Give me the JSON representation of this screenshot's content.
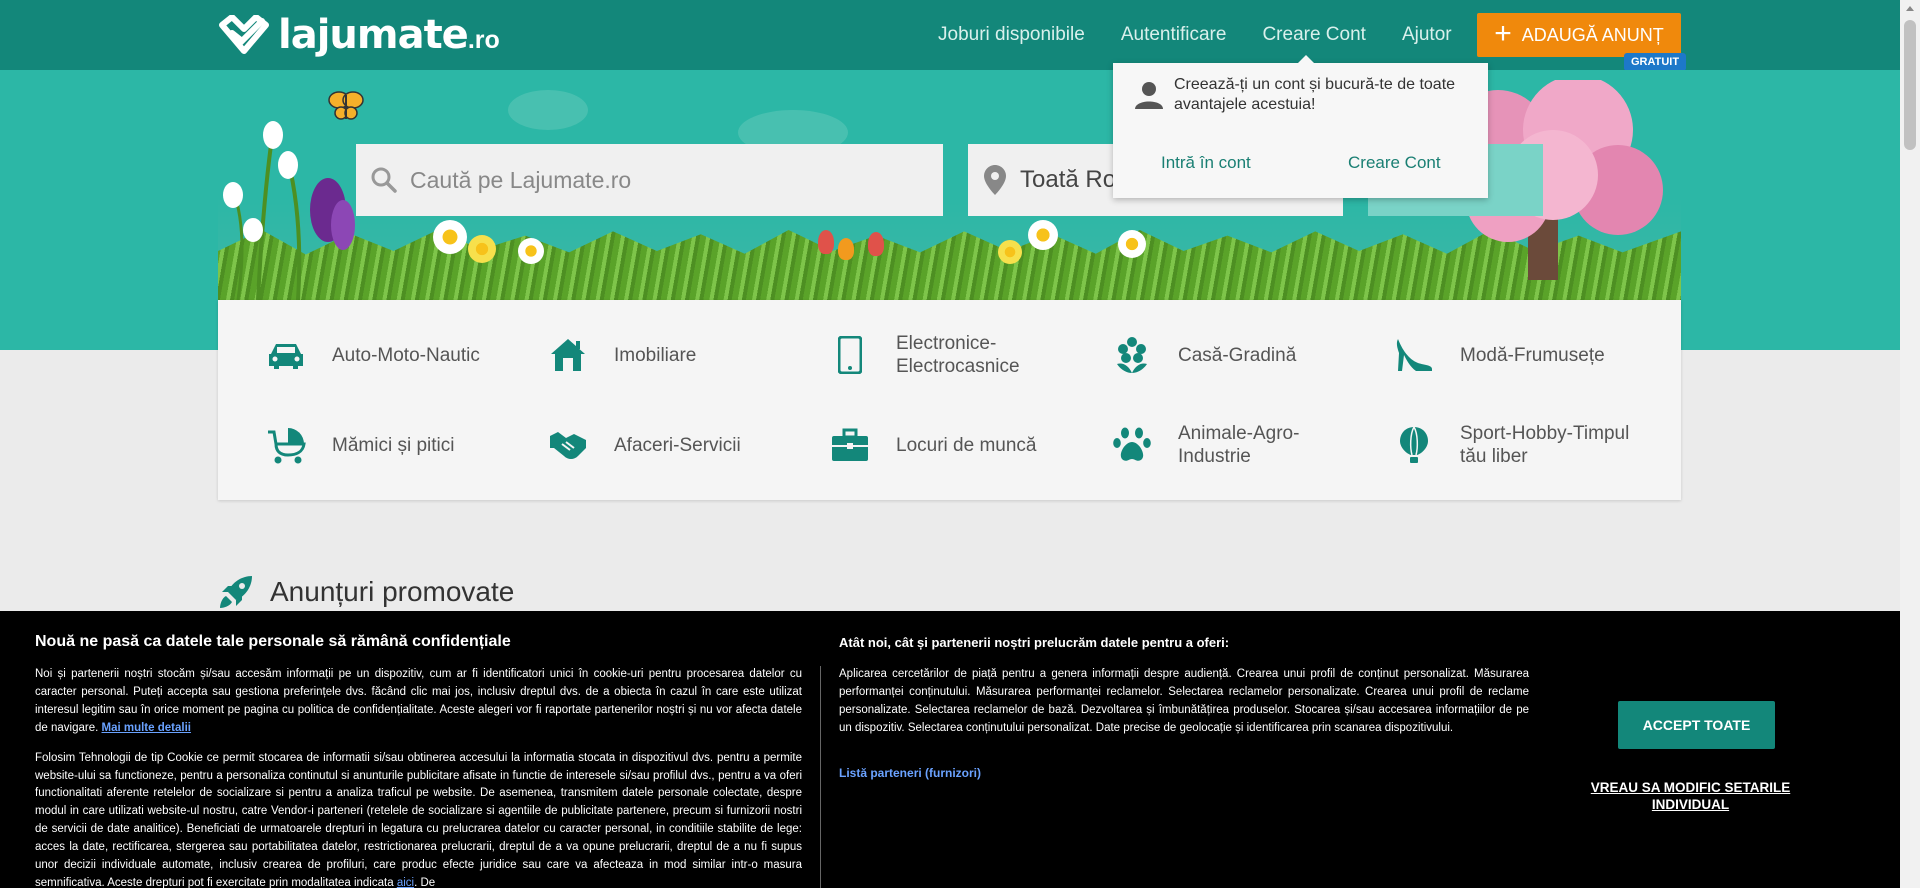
{
  "header": {
    "logo_text": "lajumate",
    "logo_tld": ".ro",
    "nav": [
      "Joburi disponibile",
      "Autentificare",
      "Creare Cont",
      "Ajutor"
    ],
    "add_button": "ADAUGĂ ANUNȚ",
    "badge": "GRATUIT"
  },
  "search": {
    "placeholder": "Caută pe Lajumate.ro",
    "location_value": "Toată Ron"
  },
  "dropdown": {
    "message": "Creează-ți un cont și bucură-te de toate avantajele acestuia!",
    "login_link": "Intră în cont",
    "create_link": "Creare Cont"
  },
  "categories": [
    {
      "label": "Auto-Moto-Nautic",
      "icon": "car-icon"
    },
    {
      "label": "Imobiliare",
      "icon": "house-icon"
    },
    {
      "label": "Electronice-Electrocasnice",
      "icon": "phone-icon"
    },
    {
      "label": "Casă-Gradină",
      "icon": "flower-icon"
    },
    {
      "label": "Modă-Frumusețe",
      "icon": "heel-icon"
    },
    {
      "label": "Mămici și pitici",
      "icon": "stroller-icon"
    },
    {
      "label": "Afaceri-Servicii",
      "icon": "handshake-icon"
    },
    {
      "label": "Locuri de muncă",
      "icon": "briefcase-icon"
    },
    {
      "label": "Animale-Agro-Industrie",
      "icon": "paw-icon"
    },
    {
      "label": "Sport-Hobby-Timpul tău liber",
      "icon": "balloon-icon"
    }
  ],
  "promoted": {
    "title": "Anunțuri promovate"
  },
  "cookie": {
    "title": "Nouă ne pasă ca datele tale personale să rămână confidențiale",
    "para1": "Noi și partenerii noștri stocăm și/sau accesăm informații pe un dispozitiv, cum ar fi identificatori unici în cookie-uri pentru procesarea datelor cu caracter personal. Puteți accepta sau gestiona preferințele dvs. făcând clic mai jos, inclusiv dreptul dvs. de a obiecta în cazul în care este utilizat interesul legitim sau în orice moment pe pagina cu politica de confidențialitate. Aceste alegeri vor fi raportate partenerilor noștri și nu vor afecta datele de navigare.",
    "more_link": "Mai multe detalii",
    "para2": "Folosim Tehnologii de tip Cookie ce permit stocarea de informatii si/sau obtinerea accesului la informatia stocata in dispozitivul dvs. pentru a permite website-ului sa functioneze, pentru a personaliza continutul si anunturile publicitare afisate in functie de interesele si/sau profilul dvs., pentru a va oferi functionalitati aferente retelelor de socializare si pentru a analiza traficul pe website. De asemenea, transmitem datele personale colectate, despre modul in care utilizati website-ul nostru, catre Vendor-i parteneri (retelele de socializare si agentiile de publicitate partenere, precum si furnizorii nostri de servicii de date analitice). Beneficiati de urmatoarele drepturi in legatura cu prelucrarea datelor cu caracter personal, in conditiile stabilite de lege: acces la date, rectificarea, stergerea sau portabilitatea datelor, restrictionarea prelucrarii, dreptul de a va opune prelucrarii, dreptul de a nu fi supus unor decizii individuale automate, inclusiv crearea de profiluri, care produc efecte juridice sau care va afecteaza in mod similar intr-o masura semnificativa. Aceste drepturi pot fi exercitate prin modalitatea indicata",
    "here_link": "aici",
    "para2_end": ". De",
    "right_title": "Atât noi, cât și partenerii noștri prelucrăm datele pentru a oferi:",
    "right_text": "Aplicarea cercetărilor de piață pentru a genera informații despre audiență. Crearea unui profil de conținut personalizat. Măsurarea performanței conținutului. Măsurarea performanței reclamelor. Selectarea reclamelor personalizate. Crearea unui profil de reclame personalizate. Selectarea reclamelor de bază. Dezvoltarea și îmbunătățirea produselor. Stocarea și/sau accesarea informațiilor de pe un dispozitiv. Selectarea conținutului personalizat. Date precise de geolocație și identificarea prin scanarea dispozitivului.",
    "partners_link": "Listă parteneri (furnizori)",
    "accept_button": "ACCEPT TOATE",
    "modify_link": "VREAU SA MODIFIC SETARILE INDIVIDUAL"
  },
  "colors": {
    "brand": "#13877a",
    "hero": "#2cb7a6",
    "accent": "#f0890c",
    "badge": "#1d78c9"
  }
}
